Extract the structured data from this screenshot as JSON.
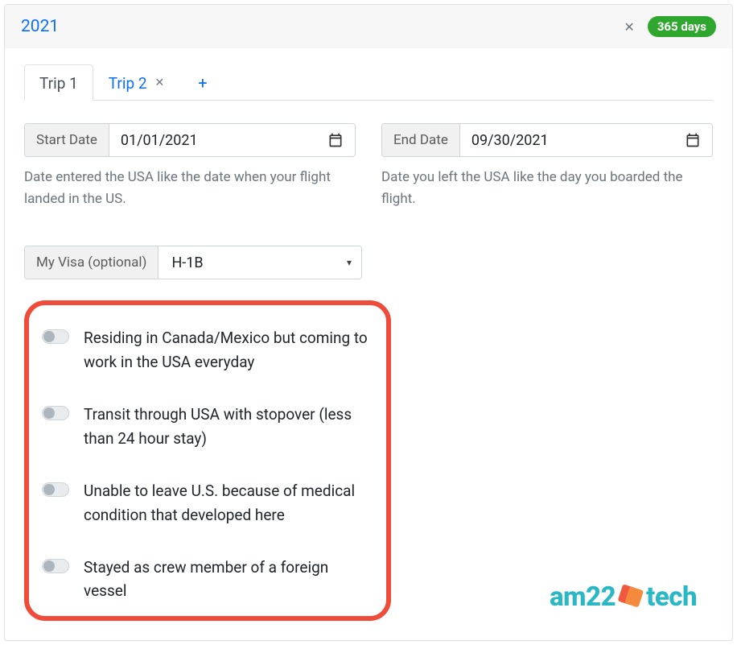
{
  "header": {
    "year": "2021",
    "close_symbol": "✕",
    "badge": "365 days"
  },
  "tabs": [
    {
      "label": "Trip 1",
      "active": true,
      "closable": false
    },
    {
      "label": "Trip 2",
      "active": false,
      "closable": true
    }
  ],
  "tab_close_symbol": "✕",
  "tab_add_symbol": "+",
  "dates": {
    "start_label": "Start Date",
    "start_value": "01/01/2021",
    "start_helper": "Date entered the USA like the date when your flight landed in the US.",
    "end_label": "End Date",
    "end_value": "09/30/2021",
    "end_helper": "Date you left the USA like the day you boarded the flight."
  },
  "visa": {
    "label": "My Visa (optional)",
    "selected": "H-1B"
  },
  "toggles": [
    {
      "label": "Residing in Canada/Mexico but coming to work in the USA everyday",
      "on": false
    },
    {
      "label": "Transit through USA with stopover (less than 24 hour stay)",
      "on": false
    },
    {
      "label": "Unable to leave U.S. because of medical condition that developed here",
      "on": false
    },
    {
      "label": "Stayed as crew member of a foreign vessel",
      "on": false
    }
  ],
  "brand": {
    "part1": "am22",
    "part2": "tech"
  }
}
